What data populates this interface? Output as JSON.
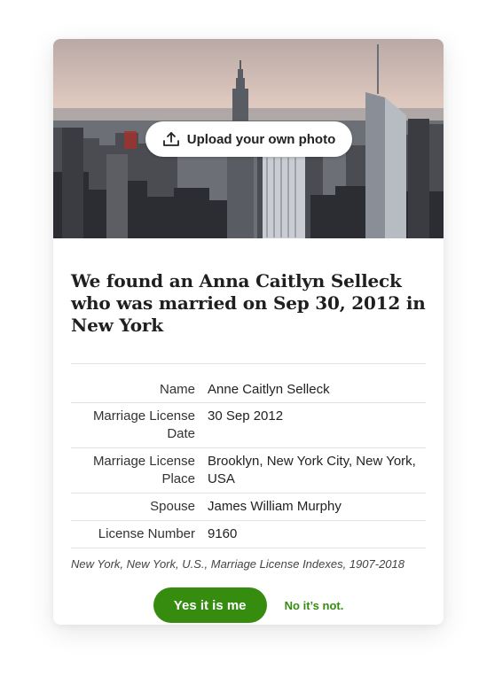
{
  "hero": {
    "upload_label": "Upload your own photo",
    "image_subject": "New York City skyline",
    "upload_icon": "upload-icon"
  },
  "heading": "We found an Anna Caitlyn Selleck who was married on Sep 30, 2012 in New York",
  "records": [
    {
      "label": "Name",
      "value": "Anne Caitlyn Selleck"
    },
    {
      "label": "Marriage License Date",
      "value": "30 Sep 2012"
    },
    {
      "label": "Marriage License Place",
      "value": "Brooklyn, New York City, New York, USA"
    },
    {
      "label": "Spouse",
      "value": "James William Murphy"
    },
    {
      "label": "License Number",
      "value": "9160"
    }
  ],
  "source": "New York, New York, U.S., Marriage License Indexes, 1907-2018",
  "actions": {
    "yes_label": "Yes it is me",
    "no_label": "No it’s not."
  },
  "colors": {
    "primary_green": "#358c0f",
    "text": "#222222",
    "divider": "#e3e3e3"
  }
}
